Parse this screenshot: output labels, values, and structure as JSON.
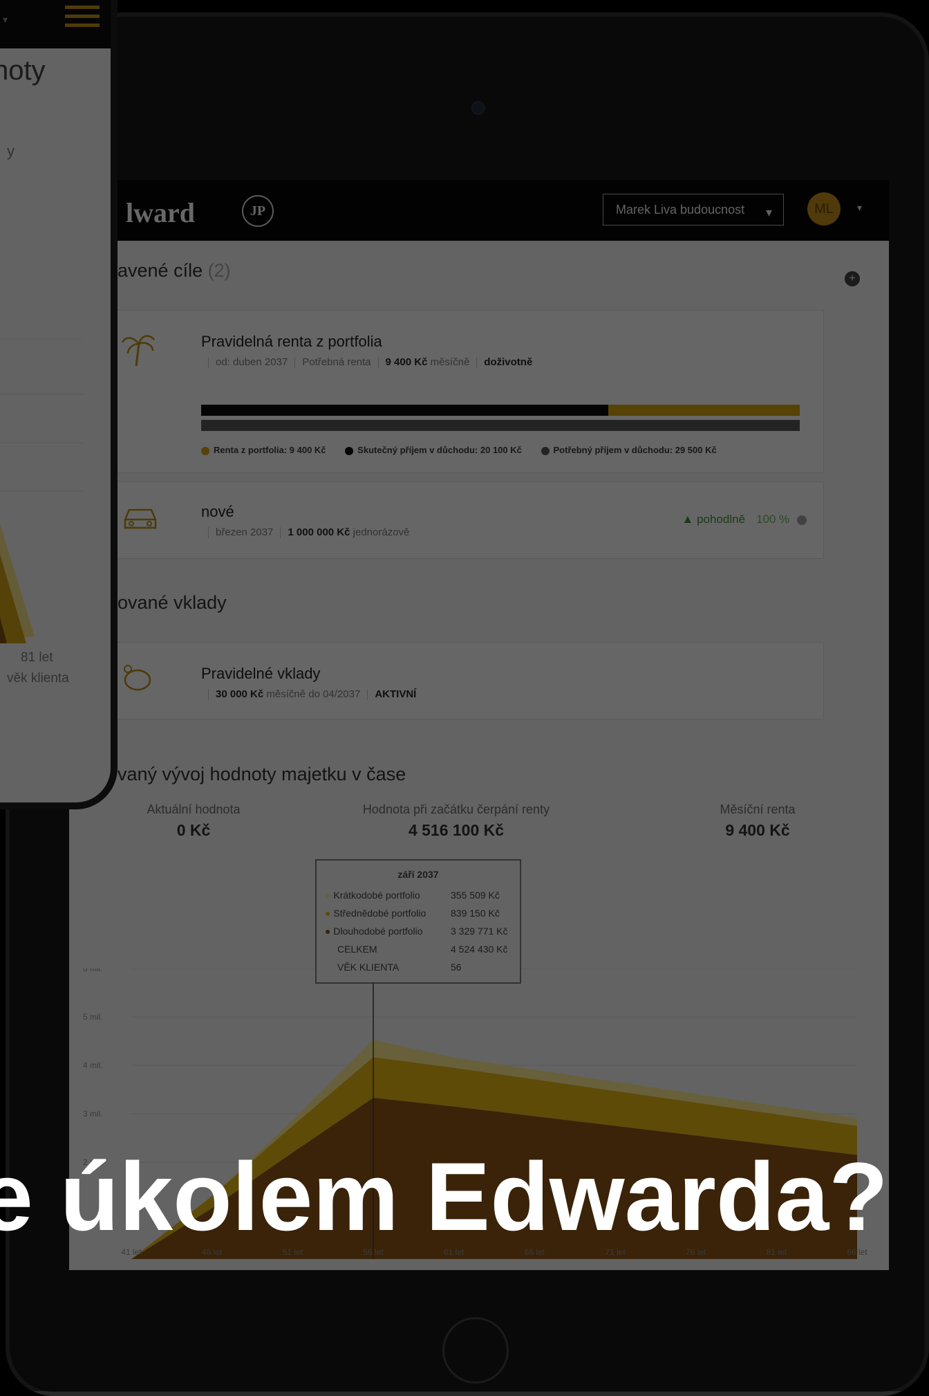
{
  "headline": "e úkolem Edwarda?",
  "phone": {
    "title": "noty",
    "sub": "y",
    "age_label": "81 let",
    "x_label": "věk klienta"
  },
  "app": {
    "brand": "lward",
    "brand_mark": "JP",
    "account": "Marek Liva budoucnost",
    "avatar": "ML"
  },
  "goals": {
    "title": "avené cíle",
    "count": "(2)",
    "items": [
      {
        "icon": "palm-tree-icon",
        "title": "Pravidelná renta z portfolia",
        "from": "od: duben 2037",
        "needed_label": "Potřebná renta",
        "amount": "9 400 Kč",
        "period": "měsíčně",
        "duration": "doživotně",
        "progress_fraction": 0.68,
        "legend": [
          {
            "label": "Renta z portfolia: 9 400 Kč",
            "color": "#b58d0c"
          },
          {
            "label": "Skutečný příjem v důchodu: 20 100 Kč",
            "color": "#0c0c0c"
          },
          {
            "label": "Potřebný příjem v důchodu: 29 500 Kč",
            "color": "#4a4a4a"
          }
        ]
      },
      {
        "icon": "car-icon",
        "title": "nové",
        "date": "březen 2037",
        "amount": "1 000 000 Kč",
        "period": "jednorázově",
        "status": "pohodlně",
        "percent": "100 %"
      }
    ]
  },
  "deposits": {
    "title": "ované vklady",
    "items": [
      {
        "icon": "piggy-bank-icon",
        "title": "Pravidelné vklady",
        "amount": "30 000 Kč",
        "detail": "měsíčně do 04/2037",
        "status": "AKTIVNÍ"
      }
    ]
  },
  "projection": {
    "title": "vaný vývoj hodnoty majetku v čase",
    "stats": [
      {
        "label": "Aktuální hodnota",
        "value": "0 Kč"
      },
      {
        "label": "Hodnota při začátku čerpání renty",
        "value": "4 516 100 Kč"
      },
      {
        "label": "Měsíční renta",
        "value": "9 400 Kč"
      }
    ],
    "tooltip": {
      "title": "září 2037",
      "rows": [
        {
          "label": "Krátkodobé portfolio",
          "value": "355 509 Kč",
          "color": "#d9c97a"
        },
        {
          "label": "Střednědobé portfolio",
          "value": "839 150 Kč",
          "color": "#c59d12"
        },
        {
          "label": "Dlouhodobé portfolio",
          "value": "3 329 771 Kč",
          "color": "#7a4a12"
        },
        {
          "label": "CELKEM",
          "value": "4 524 430 Kč",
          "color": ""
        },
        {
          "label": "VĚK KLIENTA",
          "value": "56",
          "color": ""
        }
      ]
    }
  },
  "chart_data": {
    "type": "area",
    "x": [
      41,
      46,
      51,
      56,
      61,
      66,
      71,
      76,
      81,
      86
    ],
    "tick_labels_x": [
      "41 let",
      "46 let",
      "51 let",
      "56 let",
      "61 let",
      "66 let",
      "71 let",
      "76 let",
      "81 let",
      "86 let"
    ],
    "tick_labels_y": [
      "2 mil.",
      "3 mil.",
      "4 mil.",
      "5 mil.",
      "6 mil."
    ],
    "ylim": [
      0,
      6000000
    ],
    "series": [
      {
        "name": "Dlouhodobé portfolio",
        "color": "#7a4a12",
        "values": [
          0,
          1050000,
          2200000,
          3330000,
          3150000,
          2950000,
          2750000,
          2550000,
          2350000,
          2150000
        ]
      },
      {
        "name": "Střednědobé portfolio",
        "color": "#c59d12",
        "values": [
          0,
          250000,
          550000,
          840000,
          800000,
          760000,
          720000,
          680000,
          640000,
          600000
        ]
      },
      {
        "name": "Krátkodobé portfolio",
        "color": "#d9c97a",
        "values": [
          0,
          0,
          120000,
          356000,
          210000,
          200000,
          190000,
          180000,
          170000,
          160000
        ]
      }
    ],
    "highlight_x": 56
  }
}
